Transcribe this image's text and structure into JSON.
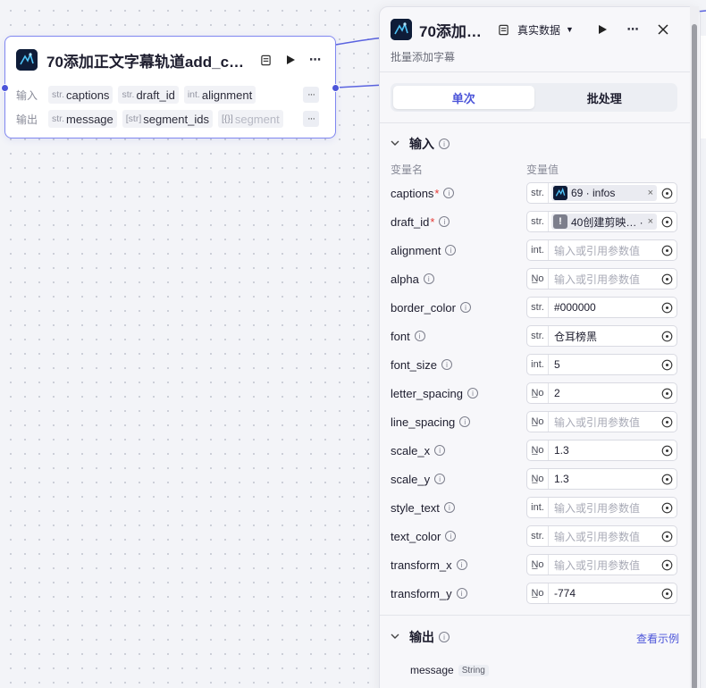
{
  "node": {
    "title": "70添加正文字幕轨道add_cap…",
    "input_label": "输入",
    "output_label": "输出",
    "inputs": [
      {
        "type": "str.",
        "name": "captions"
      },
      {
        "type": "str.",
        "name": "draft_id"
      },
      {
        "type": "int.",
        "name": "alignment"
      }
    ],
    "outputs": [
      {
        "type": "str.",
        "name": "message"
      },
      {
        "type": "[str]",
        "name": "segment_ids"
      },
      {
        "type": "[{}]",
        "name": "segment"
      }
    ]
  },
  "panel": {
    "title": "70添加…",
    "data_select": "真实数据",
    "subtitle": "批量添加字幕",
    "tabs": [
      "单次",
      "批处理"
    ],
    "input_section": "输入",
    "col_name": "变量名",
    "col_value": "变量值",
    "output_section": "输出",
    "view_example": "查看示例",
    "output_name": "message",
    "output_type": "String"
  },
  "params": [
    {
      "name": "captions",
      "required": "*",
      "type": "str.",
      "ref": "69 · infos",
      "value": "",
      "placeholder": ""
    },
    {
      "name": "draft_id",
      "required": "*",
      "type": "str.",
      "ref": "40创建剪映…  ·",
      "value": "",
      "placeholder": ""
    },
    {
      "name": "alignment",
      "required": "",
      "type": "int.",
      "value": "",
      "placeholder": "输入或引用参数值"
    },
    {
      "name": "alpha",
      "required": "",
      "type": "N̲o",
      "value": "",
      "placeholder": "输入或引用参数值"
    },
    {
      "name": "border_color",
      "required": "",
      "type": "str.",
      "value": "#000000",
      "placeholder": ""
    },
    {
      "name": "font",
      "required": "",
      "type": "str.",
      "value": "仓耳榜黑",
      "placeholder": ""
    },
    {
      "name": "font_size",
      "required": "",
      "type": "int.",
      "value": "5",
      "placeholder": ""
    },
    {
      "name": "letter_spacing",
      "required": "",
      "type": "N̲o",
      "value": "2",
      "placeholder": ""
    },
    {
      "name": "line_spacing",
      "required": "",
      "type": "N̲o",
      "value": "",
      "placeholder": "输入或引用参数值"
    },
    {
      "name": "scale_x",
      "required": "",
      "type": "N̲o",
      "value": "1.3",
      "placeholder": ""
    },
    {
      "name": "scale_y",
      "required": "",
      "type": "N̲o",
      "value": "1.3",
      "placeholder": ""
    },
    {
      "name": "style_text",
      "required": "",
      "type": "int.",
      "value": "",
      "placeholder": "输入或引用参数值"
    },
    {
      "name": "text_color",
      "required": "",
      "type": "str.",
      "value": "",
      "placeholder": "输入或引用参数值"
    },
    {
      "name": "transform_x",
      "required": "",
      "type": "N̲o",
      "value": "",
      "placeholder": "输入或引用参数值"
    },
    {
      "name": "transform_y",
      "required": "",
      "type": "N̲o",
      "value": "-774",
      "placeholder": ""
    }
  ],
  "colors": {
    "accent": "#4c55d9",
    "node_border": "#8087f0",
    "required": "#e53935"
  }
}
